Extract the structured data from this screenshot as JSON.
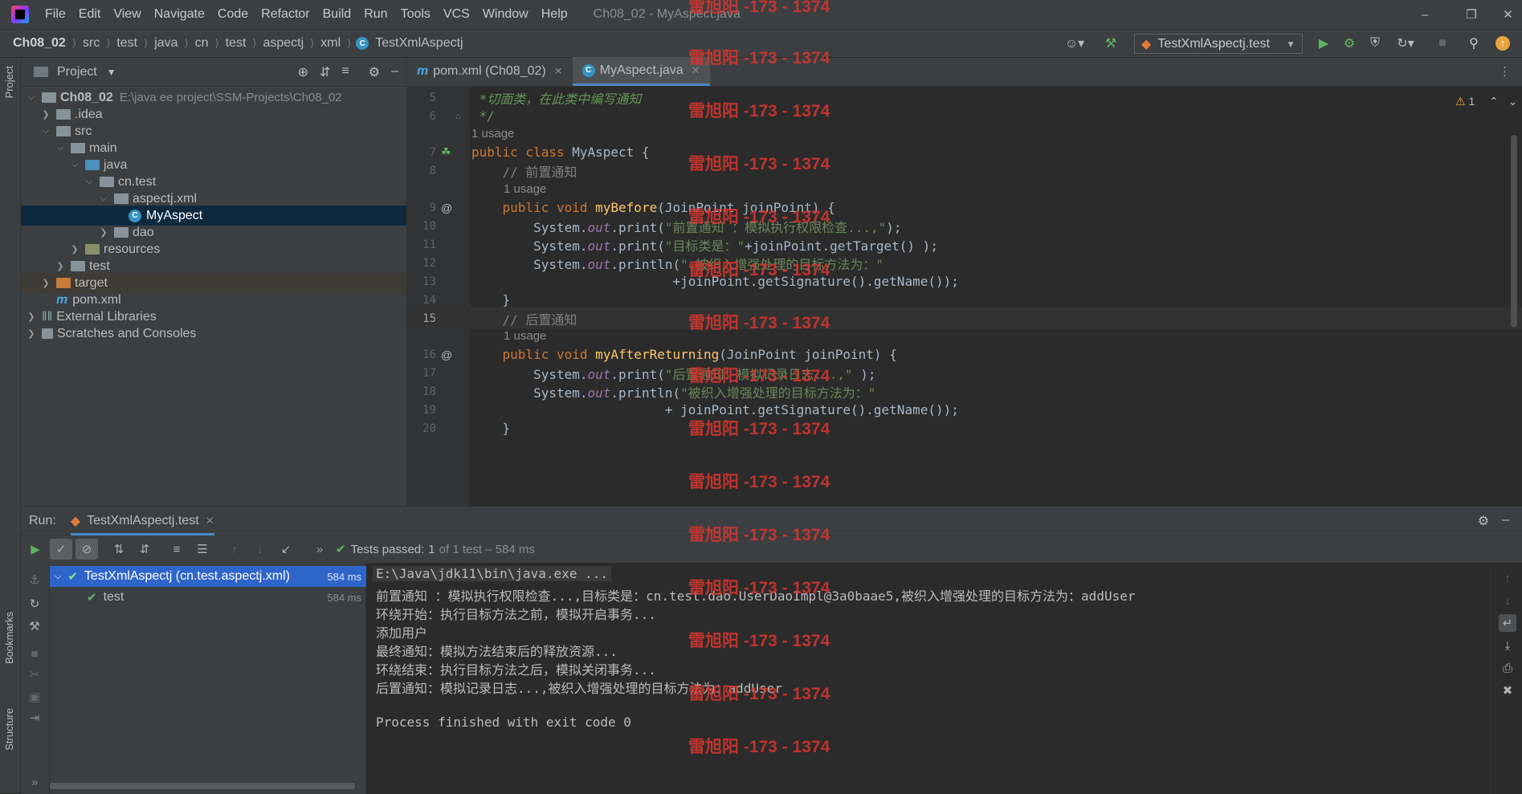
{
  "menubar": {
    "items": [
      "File",
      "Edit",
      "View",
      "Navigate",
      "Code",
      "Refactor",
      "Build",
      "Run",
      "Tools",
      "VCS",
      "Window",
      "Help"
    ],
    "title": "Ch08_02 - MyAspect.java"
  },
  "breadcrumb": [
    "Ch08_02",
    "src",
    "test",
    "java",
    "cn",
    "test",
    "aspectj",
    "xml",
    "TestXmlAspectj"
  ],
  "run_config": "TestXmlAspectj.test",
  "project_panel": {
    "title": "Project",
    "tree": [
      {
        "label": "Ch08_02",
        "path": "E:\\java ee project\\SSM-Projects\\Ch08_02"
      },
      {
        "label": ".idea"
      },
      {
        "label": "src"
      },
      {
        "label": "main"
      },
      {
        "label": "java"
      },
      {
        "label": "cn.test"
      },
      {
        "label": "aspectj.xml"
      },
      {
        "label": "MyAspect"
      },
      {
        "label": "dao"
      },
      {
        "label": "resources"
      },
      {
        "label": "test"
      },
      {
        "label": "target"
      },
      {
        "label": "pom.xml"
      },
      {
        "label": "External Libraries"
      },
      {
        "label": "Scratches and Consoles"
      }
    ]
  },
  "editor": {
    "tabs": [
      {
        "label": "pom.xml (Ch08_02)"
      },
      {
        "label": "MyAspect.java"
      }
    ],
    "usage_hint": "1 usage",
    "warning_count": "1",
    "line_numbers": [
      "5",
      "6",
      "7",
      "8",
      "9",
      "10",
      "11",
      "12",
      "13",
      "14",
      "15",
      "16",
      "17",
      "18",
      "19",
      "20"
    ]
  },
  "run_panel": {
    "title": "Run:",
    "tab": "TestXmlAspectj.test",
    "status_prefix": "Tests passed:",
    "status_count": "1",
    "status_suffix": "of 1 test – 584 ms",
    "tests": [
      {
        "name": "TestXmlAspectj (cn.test.aspectj.xml)",
        "time": "584 ms"
      },
      {
        "name": "test",
        "time": "584 ms"
      }
    ],
    "console": [
      "E:\\Java\\jdk11\\bin\\java.exe ...",
      "前置通知 ：模拟执行权限检查...,目标类是：cn.test.dao.UserDaoImpl@3a0baae5,被织入增强处理的目标方法为：addUser",
      "环绕开始：执行目标方法之前，模拟开启事务...",
      "添加用户",
      "最终通知：模拟方法结束后的释放资源...",
      "环绕结束：执行目标方法之后，模拟关闭事务...",
      "后置通知：模拟记录日志...,被织入增强处理的目标方法为：addUser",
      "",
      "Process finished with exit code 0"
    ]
  },
  "side_labels": {
    "project": "Project",
    "bookmarks": "Bookmarks",
    "structure": "Structure"
  },
  "watermark": "雷旭阳 -173 - 1374",
  "colors": {
    "selection": "#0d293e",
    "accent": "#4a88c7",
    "pass": "#5fb55f",
    "watermark": "#d9352f"
  }
}
